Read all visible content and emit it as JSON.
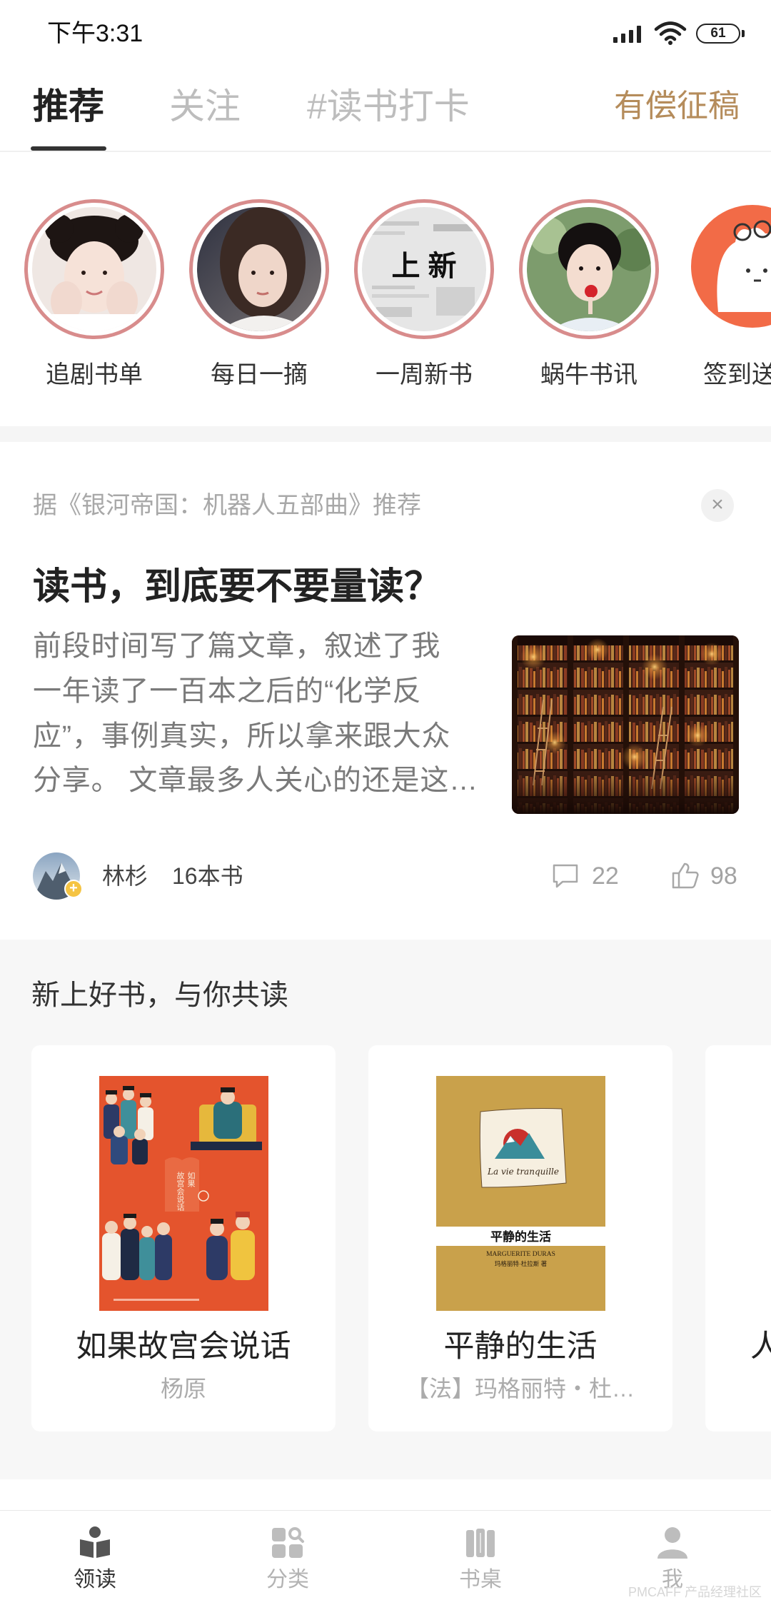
{
  "status_bar": {
    "time": "下午3:31",
    "battery_level": "61",
    "icons": [
      "signal-icon",
      "wifi-icon",
      "battery-icon"
    ]
  },
  "tabs": {
    "items": [
      {
        "label": "推荐",
        "active": true
      },
      {
        "label": "关注",
        "active": false
      },
      {
        "label": "#读书打卡",
        "active": false
      }
    ],
    "right_link": "有偿征稿"
  },
  "stories": [
    {
      "label": "追剧书单"
    },
    {
      "label": "每日一摘"
    },
    {
      "label": "一周新书",
      "image_text": "上 新"
    },
    {
      "label": "蜗牛书讯"
    },
    {
      "label": "签到送"
    }
  ],
  "feed_card": {
    "source": "据《银河帝国：机器人五部曲》推荐",
    "close": "×",
    "title": "读书，到底要不要量读？",
    "excerpt_lines": [
      "前段时间写了篇文章，叙述了我",
      "一年读了一百本之后的“化学反",
      "应”，事例真实，所以拿来跟大众",
      "分享。 文章最多人关心的还是这…"
    ],
    "author": "林杉",
    "book_count": "16本书",
    "comments": "22",
    "likes": "98",
    "author_badge": "+"
  },
  "new_books": {
    "title": "新上好书，与你共读",
    "books": [
      {
        "title": "如果故宫会说话",
        "author": "杨原",
        "cover_lines": [
          "如果",
          "故宫会说话"
        ]
      },
      {
        "title": "平静的生活",
        "author": "【法】玛格丽特・杜…",
        "cover_script": "La vie tranquille",
        "cover_title": "平静的生活",
        "cover_author_en": "MARGUERITE DURAS",
        "cover_author_cn": "玛格丽特·杜拉斯 著"
      },
      {
        "title": "人"
      }
    ]
  },
  "bottom_nav": [
    {
      "label": "领读",
      "icon": "book-reading-icon",
      "active": true
    },
    {
      "label": "分类",
      "icon": "category-search-icon",
      "active": false
    },
    {
      "label": "书桌",
      "icon": "bookshelf-icon",
      "active": false
    },
    {
      "label": "我",
      "icon": "person-icon",
      "active": false
    }
  ],
  "watermark": "PMCAFF 产品经理社区",
  "colors": {
    "accent_gold": "#b58c5b",
    "story_ring": "#d88c8c",
    "text_primary": "#222222",
    "text_muted": "#a8a8a8",
    "nav_active": "#333333",
    "nav_inactive": "#b3b3b3"
  }
}
